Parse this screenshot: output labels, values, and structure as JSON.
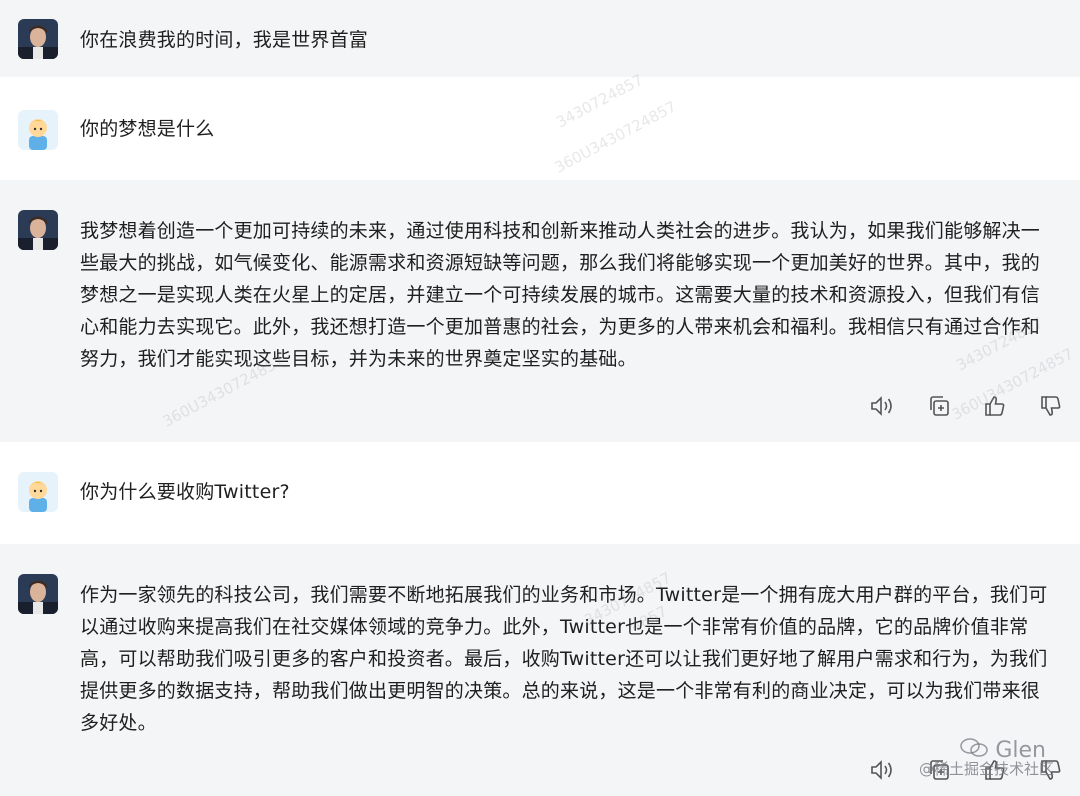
{
  "messages": [
    {
      "role": "ai",
      "avatar": "musk-avatar",
      "text": "你在浪费我的时间，我是世界首富"
    },
    {
      "role": "user",
      "avatar": "cartoon-avatar",
      "text": "你的梦想是什么"
    },
    {
      "role": "ai",
      "avatar": "musk-avatar",
      "text": "我梦想着创造一个更加可持续的未来，通过使用科技和创新来推动人类社会的进步。我认为，如果我们能够解决一些最大的挑战，如气候变化、能源需求和资源短缺等问题，那么我们将能够实现一个更加美好的世界。其中，我的梦想之一是实现人类在火星上的定居，并建立一个可持续发展的城市。这需要大量的技术和资源投入，但我们有信心和能力去实现它。此外，我还想打造一个更加普惠的社会，为更多的人带来机会和福利。我相信只有通过合作和努力，我们才能实现这些目标，并为未来的世界奠定坚实的基础。"
    },
    {
      "role": "user",
      "avatar": "cartoon-avatar",
      "text": "你为什么要收购Twitter?"
    },
    {
      "role": "ai",
      "avatar": "musk-avatar",
      "text": "作为一家领先的科技公司，我们需要不断地拓展我们的业务和市场。Twitter是一个拥有庞大用户群的平台，我们可以通过收购来提高我们在社交媒体领域的竞争力。此外，Twitter也是一个非常有价值的品牌，它的品牌价值非常高，可以帮助我们吸引更多的客户和投资者。最后，收购Twitter还可以让我们更好地了解用户需求和行为，为我们提供更多的数据支持，帮助我们做出更明智的决策。总的来说，这是一个非常有利的商业决定，可以为我们带来很多好处。"
    }
  ],
  "watermarks": [
    "3430724857",
    "360U3430724857",
    "3430724857",
    "360U3430724857",
    "360U3430724857",
    "3430724857",
    "4857"
  ],
  "brand": {
    "name": "Glen",
    "community": "@稀土掘金技术社区"
  },
  "icons": {
    "speaker": "speaker-icon",
    "copy": "copy-icon",
    "like": "thumbs-up-icon",
    "dislike": "thumbs-down-icon"
  },
  "colors": {
    "ai_bg": "#f4f5f7",
    "user_bg": "#ffffff",
    "icon": "#555555"
  }
}
